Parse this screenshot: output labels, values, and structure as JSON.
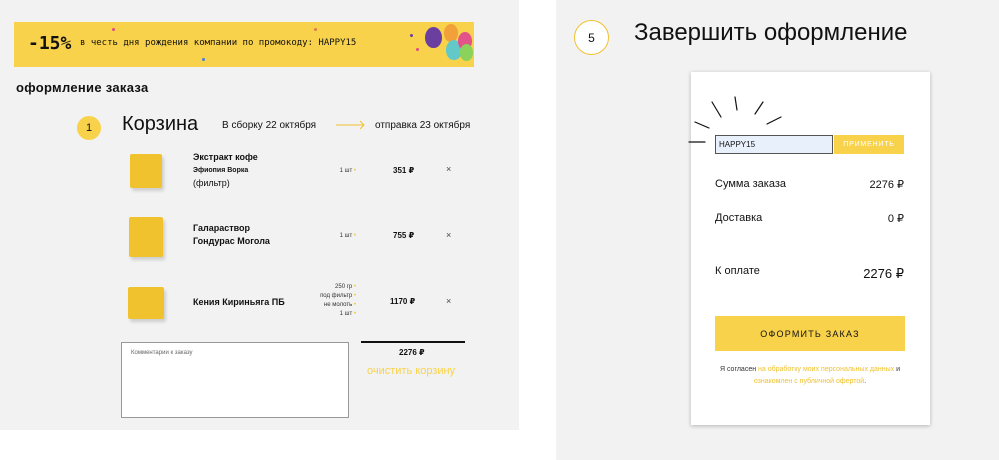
{
  "banner": {
    "discount": "-15%",
    "text": "в честь дня рождения компании по промокоду: HAPPY15",
    "colors": {
      "background": "#f8d24a"
    }
  },
  "page_title": "оформление заказа",
  "cart": {
    "step": "1",
    "title": "Корзина",
    "assembly": "В сборку 22 октября",
    "shipping": "отправка 23 октября",
    "items": [
      {
        "name": "Экстракт кофе",
        "name2": "Эфиопия Ворка",
        "name3": "(фильтр)",
        "qty": "1 шт",
        "price": "351 ₽",
        "remove": "×"
      },
      {
        "name": "Галараствор",
        "name2": "Гондурас Могола",
        "qty": "1 шт",
        "price": "755 ₽",
        "remove": "×"
      },
      {
        "name": "Кения Кириньяга ПБ",
        "qty_lines": [
          "250 гр",
          "под фильтр",
          "не молоть",
          "1 шт"
        ],
        "price": "1170 ₽",
        "remove": "×"
      }
    ],
    "comment_placeholder": "Комментарии к заказу",
    "total": "2276 ₽",
    "clear": "очистить корзину"
  },
  "checkout": {
    "step": "5",
    "title": "Завершить оформление",
    "promo_value": "HAPPY15",
    "apply": "ПРИМЕНИТЬ",
    "sum_label": "Сумма заказа",
    "sum_value": "2276 ₽",
    "delivery_label": "Доставка",
    "delivery_value": "0 ₽",
    "pay_label": "К оплате",
    "pay_value": "2276 ₽",
    "order_button": "ОФОРМИТЬ ЗАКАЗ",
    "agree_1": "Я согласен",
    "agree_link1": "на обработку моих персональных данных",
    "agree_and": "и",
    "agree_link2": "ознакомлен с публичной офертой",
    "agree_end": ".",
    "accent": "#f8d24a"
  }
}
